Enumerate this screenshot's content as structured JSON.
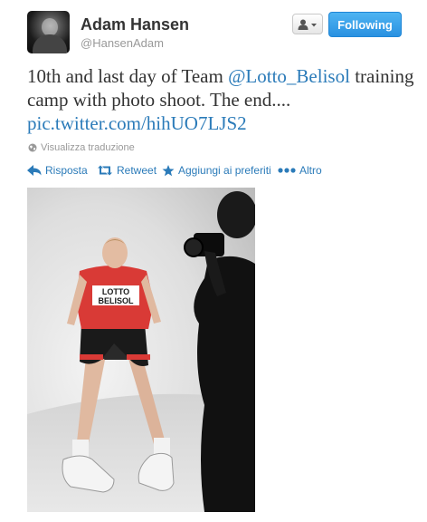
{
  "user": {
    "display_name": "Adam Hansen",
    "handle": "@HansenAdam"
  },
  "buttons": {
    "follow_label": "Following"
  },
  "tweet": {
    "text_1": "10th and last day of Team ",
    "mention": "@Lotto_Belisol",
    "text_2": " training camp with photo shoot.  The end....",
    "link": "pic.twitter.com/hihUO7LJS2"
  },
  "translate_label": "Visualizza traduzione",
  "actions": {
    "reply": "Risposta",
    "retweet": "Retweet",
    "favorite": "Aggiungi ai preferiti",
    "more": "Altro"
  },
  "photo": {
    "jersey_text_1": "LOTTO",
    "jersey_text_2": "BELISOL"
  },
  "colors": {
    "link": "#2b7bb9",
    "follow_button": "#2a91e1",
    "jersey_red": "#d93a36"
  },
  "icons": {
    "avatar": "profile-photo",
    "user_menu": "person-icon",
    "translate": "globe-icon",
    "reply": "reply-arrow-icon",
    "retweet": "retweet-icon",
    "favorite": "star-icon",
    "more": "dots-icon"
  }
}
